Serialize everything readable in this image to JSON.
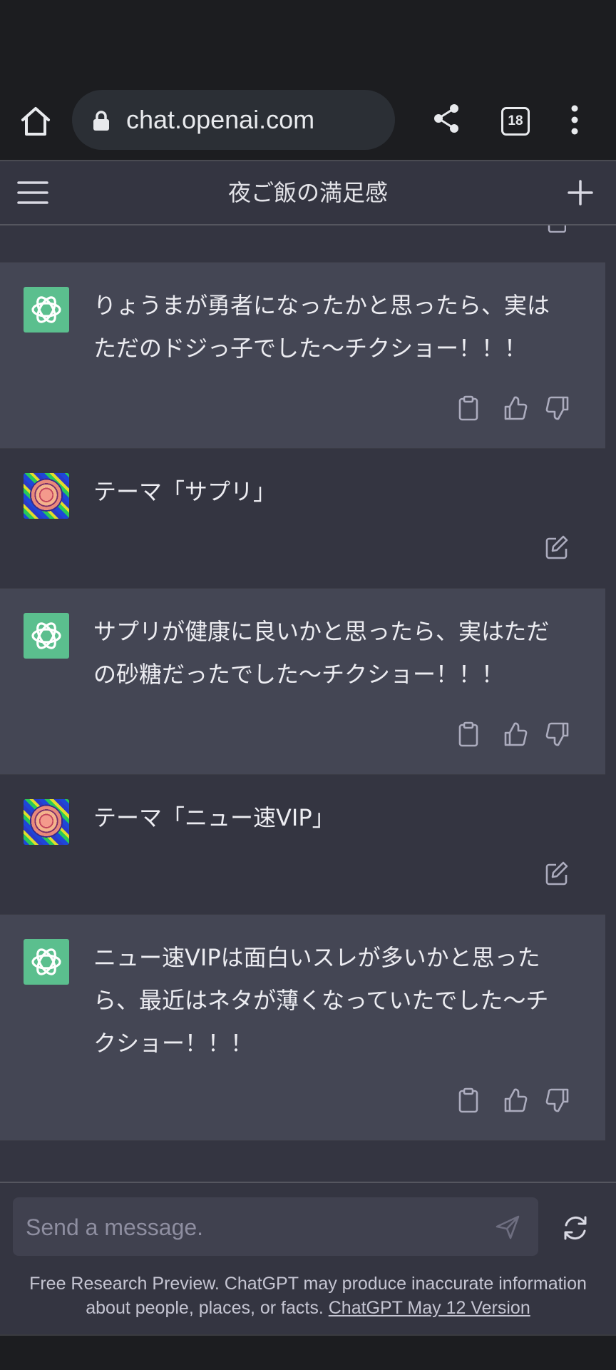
{
  "browser": {
    "url": "chat.openai.com",
    "tab_count": "18"
  },
  "chat": {
    "title": "夜ご飯の満足感"
  },
  "messages": [
    {
      "role": "assistant",
      "text": "りょうまが勇者になったかと思ったら、実は\nただのドジっ子でした〜チクショー！！！"
    },
    {
      "role": "user",
      "text": "テーマ「サプリ」"
    },
    {
      "role": "assistant",
      "text": "サプリが健康に良いかと思ったら、実はただ\nの砂糖だったでした〜チクショー！！！"
    },
    {
      "role": "user",
      "text": "テーマ「ニュー速VIP」"
    },
    {
      "role": "assistant",
      "text": "ニュー速VIPは面白いスレが多いかと思った\nら、最近はネタが薄くなっていたでした〜チ\nクショー！！！"
    }
  ],
  "composer": {
    "placeholder": "Send a message.",
    "disclaimer_text": "Free Research Preview. ChatGPT may produce inaccurate information about people, places, or facts. ",
    "version_link": "ChatGPT May 12 Version"
  },
  "icons": {
    "home": "home-icon",
    "lock": "lock-icon",
    "share": "share-icon",
    "tabs": "tab-switcher-icon",
    "menu": "more-vert-icon",
    "hamburger": "hamburger-icon",
    "plus": "plus-icon",
    "copy": "clipboard-icon",
    "thumbs_up": "thumbs-up-icon",
    "thumbs_down": "thumbs-down-icon",
    "edit": "edit-icon",
    "send": "send-icon",
    "regenerate": "regenerate-icon"
  },
  "colors": {
    "background": "#343541",
    "assistant_bg": "#444654",
    "gpt_avatar": "#5bbf8e",
    "browser_bar": "#1c1d20"
  }
}
